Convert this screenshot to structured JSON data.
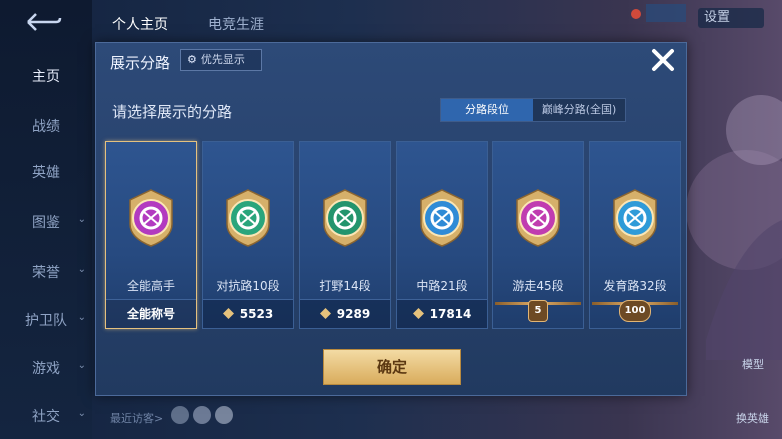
{
  "sidebar": {
    "items": [
      {
        "label": "主页",
        "active": true,
        "expandable": false
      },
      {
        "label": "战绩",
        "active": false,
        "expandable": false
      },
      {
        "label": "英雄",
        "active": false,
        "expandable": false
      },
      {
        "label": "图鉴",
        "active": false,
        "expandable": true
      },
      {
        "label": "荣誉",
        "active": false,
        "expandable": true
      },
      {
        "label": "护卫队",
        "active": false,
        "expandable": true
      },
      {
        "label": "游戏",
        "active": false,
        "expandable": true
      },
      {
        "label": "社交",
        "active": false,
        "expandable": true
      }
    ]
  },
  "topnav": {
    "tab1": "个人主页",
    "tab2": "电竞生涯",
    "settings": "设置"
  },
  "footer": {
    "recent_visitors": "最近访客>",
    "model": "模型",
    "swap_hero": "换英雄"
  },
  "dialog": {
    "title": "展示分路",
    "priority_button": "优先显示",
    "subtitle": "请选择展示的分路",
    "tabs": [
      "分路段位",
      "巅峰分路(全国)"
    ],
    "active_tab": 0,
    "confirm_button": "确定",
    "cards": [
      {
        "label": "全能高手",
        "footer_text": "全能称号",
        "footer_type": "text",
        "selected": true,
        "emblem_color": "#b23ac0",
        "emblem_icon": "allround-icon"
      },
      {
        "label": "对抗路10段",
        "footer_text": "5523",
        "footer_type": "score",
        "selected": false,
        "emblem_color": "#2aa57c",
        "emblem_icon": "clash-lane-icon"
      },
      {
        "label": "打野14段",
        "footer_text": "9289",
        "footer_type": "score",
        "selected": false,
        "emblem_color": "#23946d",
        "emblem_icon": "jungle-icon"
      },
      {
        "label": "中路21段",
        "footer_text": "17814",
        "footer_type": "score",
        "selected": false,
        "emblem_color": "#2f8bd6",
        "emblem_icon": "mid-lane-icon"
      },
      {
        "label": "游走45段",
        "footer_text": "5",
        "footer_type": "badge",
        "selected": false,
        "emblem_color": "#c03cb0",
        "emblem_icon": "roam-icon"
      },
      {
        "label": "发育路32段",
        "footer_text": "100",
        "footer_type": "badge",
        "selected": false,
        "emblem_color": "#2f9bd8",
        "emblem_icon": "farm-lane-icon"
      }
    ]
  },
  "colors": {
    "accent_gold": "#e5c17f",
    "tab_active": "#2f66ae",
    "dialog_bg": "#2b4672"
  }
}
